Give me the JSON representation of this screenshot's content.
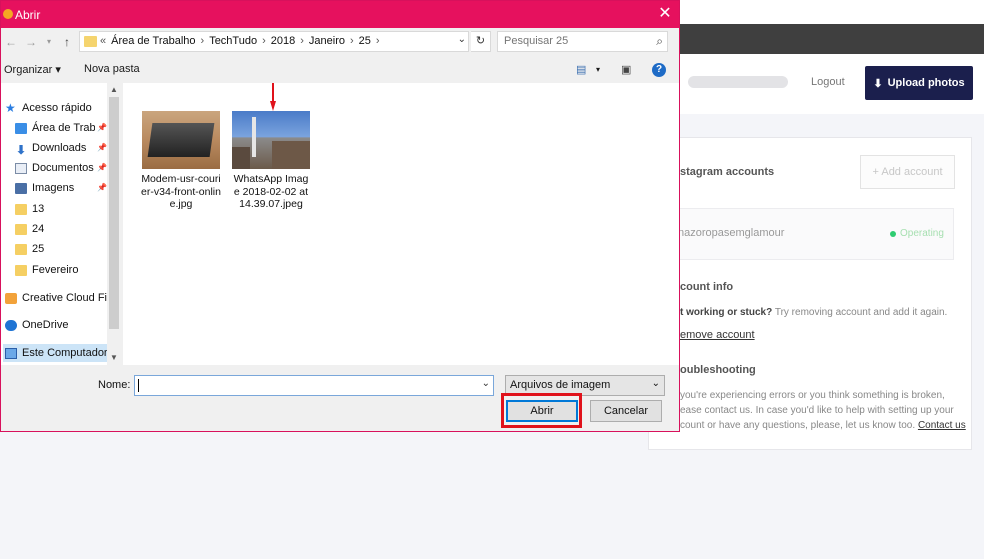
{
  "background": {
    "logout": "Logout",
    "upload_button": "Upload photos",
    "accounts_heading": "stagram accounts",
    "add_account": "+ Add account",
    "account_name": "nazoropasemglamour",
    "account_status": "Operating",
    "account_info_heading": "count info",
    "stuck_bold": "t working or stuck?",
    "stuck_text": " Try removing account and add it again.",
    "remove_link": "emove account",
    "troubleshooting_heading": "oubleshooting",
    "ts_line1": "you're experiencing errors or you think something is broken,",
    "ts_line2": "ease contact us. In case you'd like to help with setting up your",
    "ts_line3": "count or have any questions, please, let us know too.",
    "contact_link": "Contact us"
  },
  "dialog": {
    "title": "Abrir",
    "breadcrumb": {
      "prefix": "«",
      "items": [
        "Área de Trabalho",
        "TechTudo",
        "2018",
        "Janeiro",
        "25"
      ]
    },
    "search_placeholder": "Pesquisar 25",
    "toolbar": {
      "organize": "Organizar ▾",
      "new_folder": "Nova pasta"
    },
    "nav_items": [
      {
        "label": "Acesso rápido",
        "icon": "star-icon"
      },
      {
        "label": "Área de Traba",
        "icon": "desktop-icon"
      },
      {
        "label": "Downloads",
        "icon": "download-icon"
      },
      {
        "label": "Documentos",
        "icon": "document-icon"
      },
      {
        "label": "Imagens",
        "icon": "pictures-icon"
      },
      {
        "label": "13",
        "icon": "folder-icon"
      },
      {
        "label": "24",
        "icon": "folder-icon"
      },
      {
        "label": "25",
        "icon": "folder-icon"
      },
      {
        "label": "Fevereiro",
        "icon": "folder-icon"
      },
      {
        "label": "Creative Cloud Fil",
        "icon": "creative-cloud-icon"
      },
      {
        "label": "OneDrive",
        "icon": "onedrive-icon"
      },
      {
        "label": "Este Computador",
        "icon": "computer-icon"
      }
    ],
    "files": [
      {
        "name": "Modem-usr-courier-v34-front-online.jpg"
      },
      {
        "name": "WhatsApp Image 2018-02-02 at 14.39.07.jpeg"
      }
    ],
    "filename_label": "Nome:",
    "filename_value": "",
    "file_type": "Arquivos de imagem",
    "open_button": "Abrir",
    "cancel_button": "Cancelar"
  }
}
